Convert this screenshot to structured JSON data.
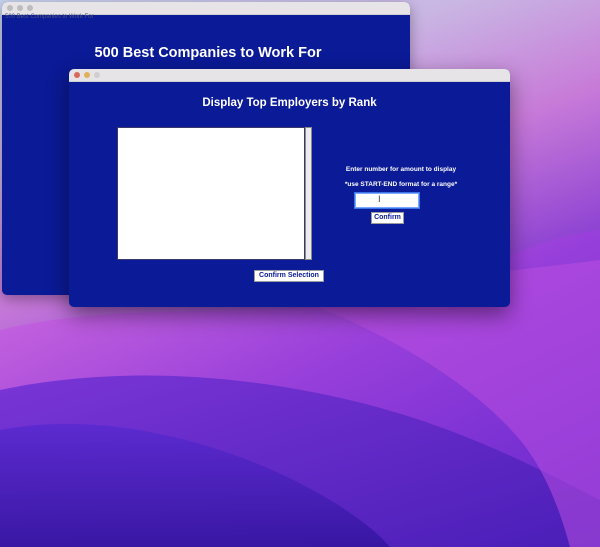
{
  "colors": {
    "window_bg": "#0b1a96",
    "titlebar": "#e6e4e7",
    "close_light": "#d96a5a",
    "minimize_light": "#e0b05a",
    "zoom_light": "#cfcfcf",
    "inactive_light": "#bdbdbd"
  },
  "back_window": {
    "caption": "500 Best Companies to Work For",
    "title": "500 Best Companies to Work For"
  },
  "front_window": {
    "title": "Display Top Employers by Rank",
    "prompt_line1": "Enter number for amount to display",
    "prompt_line2": "*use START-END format for a range*",
    "entry_value": "",
    "confirm_label": "Confirm",
    "confirm_selection_label": "Confirm Selection",
    "cursor_glyph": "I"
  }
}
